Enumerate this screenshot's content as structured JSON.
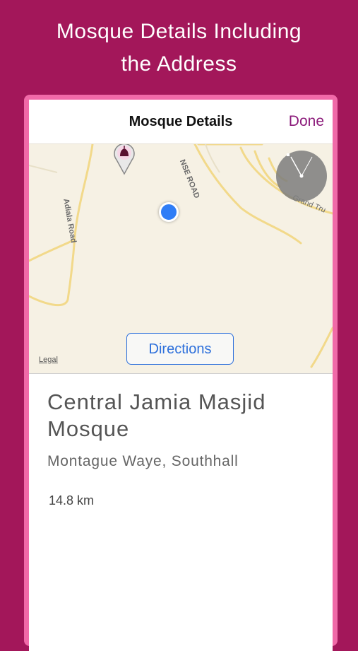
{
  "promo": {
    "line1": "Mosque Details Including",
    "line2": "the Address"
  },
  "navbar": {
    "title": "Mosque Details",
    "done_label": "Done"
  },
  "map": {
    "road_labels": {
      "adiala": "Adiala Road",
      "nse": "NSE ROAD",
      "grand_trunk": "Grand Tru"
    },
    "legal_label": "Legal",
    "directions_label": "Directions",
    "pin_icon": "mosque-pin-icon",
    "location_icon": "current-location-icon",
    "compass_icon": "compass-icon"
  },
  "mosque": {
    "name": "Central Jamia Masjid Mosque",
    "address": "Montague Waye, Southhall",
    "distance": "14.8 km"
  },
  "colors": {
    "background": "#a3175a",
    "frame": "#f06aa8",
    "accent": "#8b1a7a",
    "link": "#2c6fdb",
    "location_dot": "#2f7df6",
    "map_bg": "#f6f1e4"
  }
}
